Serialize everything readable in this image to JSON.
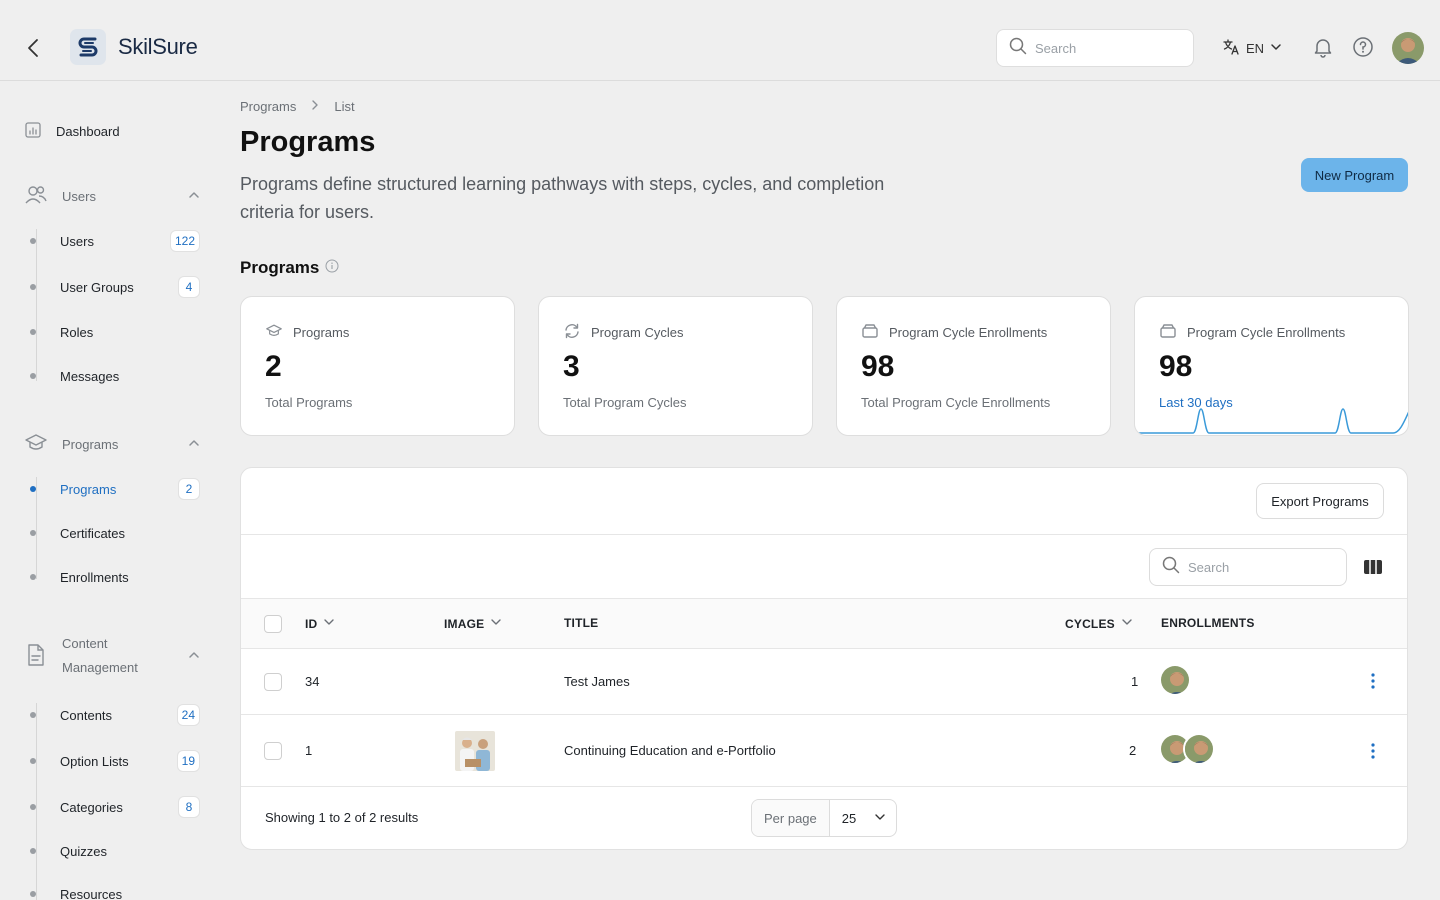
{
  "topbar": {
    "brand": "SkilSure",
    "search_placeholder": "Search",
    "language": "EN"
  },
  "sidebar": {
    "dashboard": "Dashboard",
    "groups": [
      {
        "label": "Users",
        "items": [
          {
            "label": "Users",
            "badge": "122"
          },
          {
            "label": "User Groups",
            "badge": "4"
          },
          {
            "label": "Roles",
            "badge": ""
          },
          {
            "label": "Messages",
            "badge": ""
          }
        ]
      },
      {
        "label": "Programs",
        "items": [
          {
            "label": "Programs",
            "badge": "2"
          },
          {
            "label": "Certificates",
            "badge": ""
          },
          {
            "label": "Enrollments",
            "badge": ""
          }
        ]
      },
      {
        "label_line1": "Content",
        "label_line2": "Management",
        "items": [
          {
            "label": "Contents",
            "badge": "24"
          },
          {
            "label": "Option Lists",
            "badge": "19"
          },
          {
            "label": "Categories",
            "badge": "8"
          },
          {
            "label": "Quizzes",
            "badge": ""
          },
          {
            "label": "Resources",
            "badge": ""
          }
        ]
      }
    ]
  },
  "breadcrumb": [
    "Programs",
    "List"
  ],
  "page": {
    "title": "Programs",
    "description": "Programs define structured learning pathways with steps, cycles, and completion criteria for users.",
    "new_button": "New Program",
    "section_title": "Programs"
  },
  "stats": [
    {
      "label": "Programs",
      "value": "2",
      "sub": "Total Programs"
    },
    {
      "label": "Program Cycles",
      "value": "3",
      "sub": "Total Program Cycles"
    },
    {
      "label": "Program Cycle Enrollments",
      "value": "98",
      "sub": "Total Program Cycle Enrollments"
    },
    {
      "label": "Program Cycle Enrollments",
      "value": "98",
      "sub": "Last 30 days"
    }
  ],
  "table": {
    "export_button": "Export Programs",
    "search_placeholder": "Search",
    "columns": [
      "ID",
      "IMAGE",
      "TITLE",
      "CYCLES",
      "ENROLLMENTS"
    ],
    "rows": [
      {
        "id": "34",
        "title": "Test James",
        "cycles": "1"
      },
      {
        "id": "1",
        "title": "Continuing Education and e-Portfolio",
        "cycles": "2"
      }
    ],
    "footer": "Showing 1 to 2 of 2 results",
    "per_page_label": "Per page",
    "per_page_value": "25"
  },
  "colors": {
    "accent": "#1f6fc2",
    "primary_button": "#6cb4ea",
    "sparkline": "#3a9ad9"
  }
}
